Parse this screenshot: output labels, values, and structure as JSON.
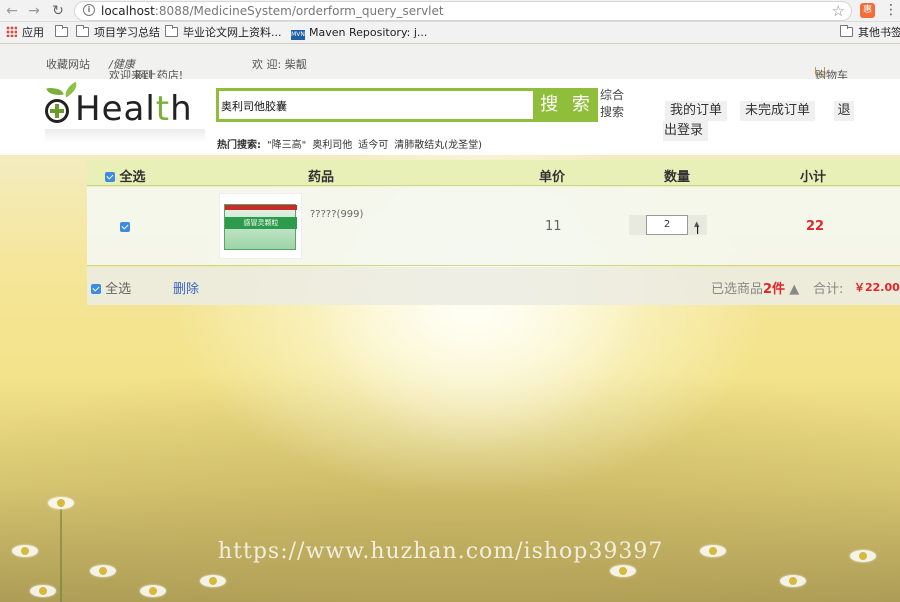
{
  "browser": {
    "url_host": "localhost",
    "url_rest": ":8088/MedicineSystem/orderform_query_servlet",
    "bookmarks": [
      "应用",
      "项目学习总结",
      "毕业论文网上资料...",
      "Maven Repository: j...",
      "其他书签"
    ],
    "maven_badge": "MVN"
  },
  "topbar": {
    "favorites": "收藏网站",
    "welcome_prefix": "欢迎来到",
    "welcome_brand": "/健康",
    "welcome_suffix": "网上药店!",
    "greeting": "欢 迎: 柴靓",
    "cart": "购物车"
  },
  "logo": {
    "text_a": "Heal",
    "text_b": "t",
    "text_c": "h"
  },
  "search": {
    "value": "奥利司他胶囊",
    "button": "搜 索",
    "advanced": "综合搜索",
    "hot_label": "热门搜索:",
    "hot_items": [
      "\"降三高\"",
      "奥利司他",
      "适今可",
      "清肺散结丸(龙圣堂)"
    ]
  },
  "header_buttons": {
    "my_orders": "我的订单",
    "pending_orders": "未完成订单",
    "logout_a": "退",
    "logout_b": "出登录"
  },
  "table": {
    "columns": {
      "select_all": "全选",
      "drug": "药品",
      "price": "单价",
      "qty": "数量",
      "subtotal": "小计"
    },
    "rows": [
      {
        "name": "?????(999)",
        "price": "11",
        "qty": "2",
        "subtotal": "22",
        "box_label": "感冒灵颗粒"
      }
    ]
  },
  "footer": {
    "select_all": "全选",
    "delete": "删除",
    "selected_prefix": "已选商品",
    "selected_count": "2件",
    "total_label": "合计:",
    "total_value": "￥22.00"
  },
  "watermark": "https://www.huzhan.com/ishop39397"
}
